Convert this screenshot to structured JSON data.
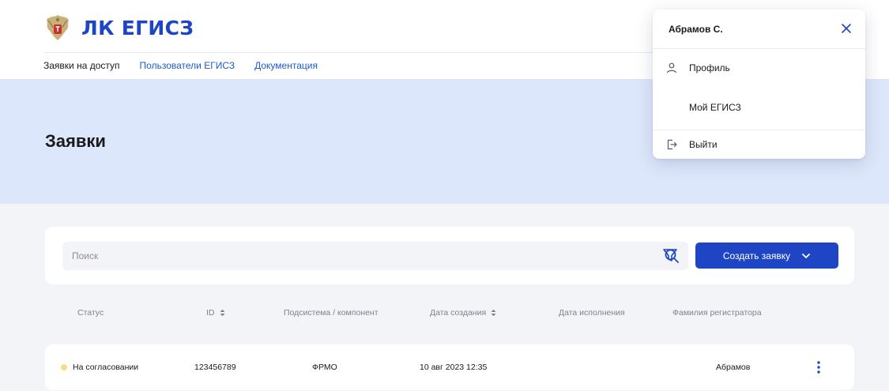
{
  "brand": {
    "name": "ЛК ЕГИСЗ",
    "accent": "#1e46c4"
  },
  "nav": [
    {
      "label": "Заявки на доступ",
      "active": true
    },
    {
      "label": "Пользователи ЕГИСЗ",
      "active": false
    },
    {
      "label": "Документация",
      "active": false
    }
  ],
  "page": {
    "title": "Заявки"
  },
  "toolbar": {
    "search_placeholder": "Поиск",
    "search_value": "",
    "create_label": "Создать заявку"
  },
  "table": {
    "columns": [
      {
        "label": "Статус",
        "sortable": false
      },
      {
        "label": "ID",
        "sortable": true
      },
      {
        "label": "Подсистема / компонент",
        "sortable": false
      },
      {
        "label": "Дата создания",
        "sortable": true
      },
      {
        "label": "Дата исполнения",
        "sortable": false
      },
      {
        "label": "Фамилия регистратора",
        "sortable": false
      }
    ],
    "rows": [
      {
        "status": "На согласовании",
        "status_color": "#f7dc86",
        "id": "123456789",
        "subsystem": "ФРМО",
        "created": "10 авг 2023  12:35",
        "done": "",
        "registrar": "Абрамов"
      }
    ]
  },
  "user_menu": {
    "user_name": "Абрамов С.",
    "items": [
      {
        "label": "Профиль",
        "icon": "user-icon"
      },
      {
        "label": "Мой ЕГИСЗ",
        "icon": ""
      },
      {
        "label": "Выйти",
        "icon": "logout-icon"
      }
    ]
  },
  "icons": {
    "logo": "emblem-icon",
    "search": "search-icon",
    "filter": "filter-icon",
    "create_dropdown": "chevron-down-icon",
    "sort": "sort-icon",
    "row_menu": "kebab-menu-icon",
    "close": "close-icon"
  }
}
